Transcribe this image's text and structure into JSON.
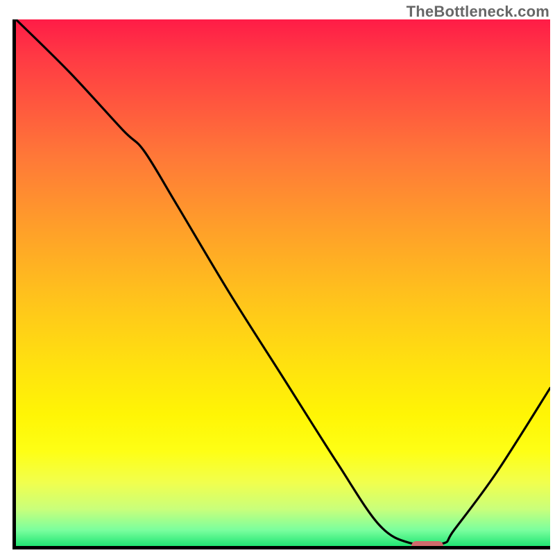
{
  "watermark": "TheBottleneck.com",
  "plot": {
    "inner_width": 770,
    "inner_height": 759
  },
  "chart_data": {
    "type": "line",
    "title": "",
    "xlabel": "",
    "ylabel": "",
    "xlim": [
      0,
      100
    ],
    "ylim": [
      0,
      100
    ],
    "x": [
      0,
      10,
      20,
      24,
      30,
      40,
      50,
      60,
      68,
      74,
      80,
      82,
      90,
      100
    ],
    "values": [
      100,
      90,
      79,
      75,
      65,
      48,
      32,
      16,
      4,
      0.5,
      0.5,
      3,
      14,
      30
    ],
    "marker_range_x": [
      74,
      80
    ],
    "gradient_stops": [
      {
        "pos": 0,
        "color": "#ff1c47"
      },
      {
        "pos": 7,
        "color": "#ff3944"
      },
      {
        "pos": 26,
        "color": "#ff7838"
      },
      {
        "pos": 40,
        "color": "#ffa029"
      },
      {
        "pos": 53,
        "color": "#ffc31c"
      },
      {
        "pos": 65,
        "color": "#ffe010"
      },
      {
        "pos": 75,
        "color": "#fff505"
      },
      {
        "pos": 82,
        "color": "#feff15"
      },
      {
        "pos": 88,
        "color": "#f1ff4e"
      },
      {
        "pos": 93,
        "color": "#c9ff7b"
      },
      {
        "pos": 97,
        "color": "#7aff9e"
      },
      {
        "pos": 100,
        "color": "#21e573"
      }
    ],
    "marker_color": "#cf6a6c"
  }
}
